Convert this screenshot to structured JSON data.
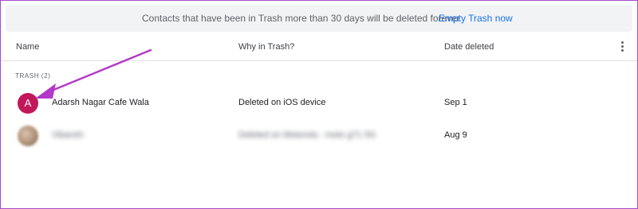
{
  "banner": {
    "message": "Contacts that have been in Trash more than 30 days will be deleted forever",
    "action_label": "Empty Trash now"
  },
  "table": {
    "columns": {
      "name": "Name",
      "why": "Why in Trash?",
      "date": "Date deleted"
    },
    "more_icon": "more-vert-icon"
  },
  "section": {
    "label": "TRASH (2)"
  },
  "contacts": [
    {
      "avatar_letter": "A",
      "avatar_color": "#c2185b",
      "name": "Adarsh Nagar Cafe Wala",
      "reason": "Deleted on iOS device",
      "date": "Sep 1"
    },
    {
      "name": "Vibansh",
      "reason": "Deleted on Motorola - moto g71 5G",
      "date": "Aug 9"
    }
  ],
  "colors": {
    "annotation_arrow": "#b238c9",
    "link": "#1a73e8",
    "banner_bg": "#f1f3f4"
  }
}
